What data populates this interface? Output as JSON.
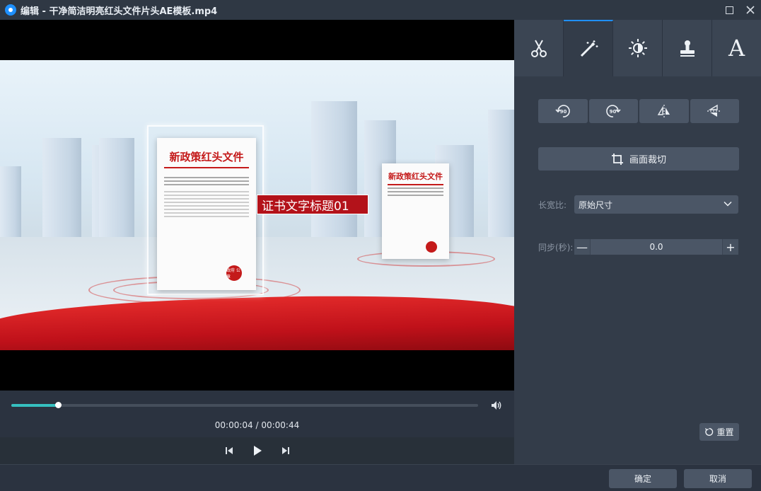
{
  "window": {
    "title": "编辑 - 干净简洁明亮红头文件片头AE模板.mp4"
  },
  "video": {
    "doc_main_title": "新政策红头文件",
    "doc_small_title": "新政策红头文件",
    "caption": "证书文字标题01",
    "seal_text": "政府\n公章"
  },
  "player": {
    "current_time": "00:00:04",
    "separator": " / ",
    "total_time": "00:00:44",
    "progress": 0.1
  },
  "tabs": [
    {
      "icon": "scissors-icon"
    },
    {
      "icon": "magic-wand-icon"
    },
    {
      "icon": "brightness-icon"
    },
    {
      "icon": "stamp-icon"
    },
    {
      "icon": "text-icon",
      "glyph": "A"
    }
  ],
  "rotate": {
    "ccw_label": "90",
    "cw_label": "90"
  },
  "crop": {
    "label": "画面裁切"
  },
  "aspect": {
    "label": "长宽比:",
    "value": "原始尺寸"
  },
  "sync": {
    "label": "同步(秒):",
    "value": "0.0",
    "minus": "—",
    "plus": "+"
  },
  "reset": {
    "label": "重置"
  },
  "footer": {
    "ok_label": "确定",
    "cancel_label": "取消"
  },
  "colors": {
    "accent": "#1f8fff",
    "progress": "#36c0c0",
    "panel": "#333c49"
  }
}
